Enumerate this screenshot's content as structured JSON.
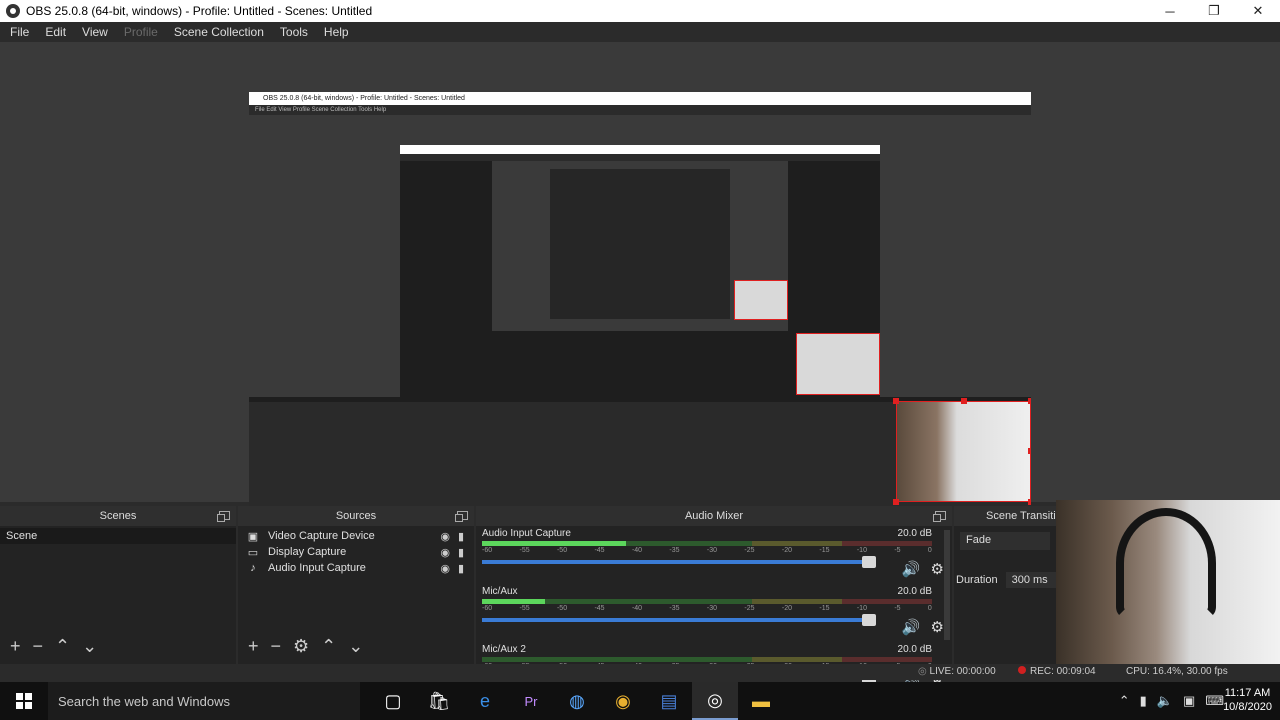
{
  "window": {
    "title": "OBS 25.0.8 (64-bit, windows) - Profile: Untitled - Scenes: Untitled",
    "minimize": "─",
    "restore": "❐",
    "close": "✕"
  },
  "menu": [
    "File",
    "Edit",
    "View",
    "Profile",
    "Scene Collection",
    "Tools",
    "Help"
  ],
  "preview": {
    "nested_title": "OBS 25.0.8 (64-bit, windows) - Profile: Untitled - Scenes: Untitled",
    "nested_menu": "File   Edit   View   Profile   Scene Collection   Tools   Help"
  },
  "scenes": {
    "title": "Scenes",
    "items": [
      "Scene"
    ]
  },
  "sources": {
    "title": "Sources",
    "items": [
      {
        "icon": "camera-icon",
        "glyph": "▣",
        "label": "Video Capture Device"
      },
      {
        "icon": "monitor-icon",
        "glyph": "▭",
        "label": "Display Capture"
      },
      {
        "icon": "microphone-icon",
        "glyph": "♪",
        "label": "Audio Input Capture"
      }
    ]
  },
  "mixer": {
    "title": "Audio Mixer",
    "ticks": [
      "-60",
      "-55",
      "-50",
      "-45",
      "-40",
      "-35",
      "-30",
      "-25",
      "-20",
      "-15",
      "-10",
      "-5",
      "0"
    ],
    "tracks": [
      {
        "name": "Audio Input Capture",
        "db": "20.0 dB",
        "level": 0.32,
        "volume": 1.0
      },
      {
        "name": "Mic/Aux",
        "db": "20.0 dB",
        "level": 0.14,
        "volume": 1.0
      },
      {
        "name": "Mic/Aux 2",
        "db": "20.0 dB",
        "level": 0.0,
        "volume": 1.0
      }
    ]
  },
  "transitions": {
    "title": "Scene Transitions",
    "selected": "Fade",
    "duration_label": "Duration",
    "duration_value": "300 ms"
  },
  "status": {
    "live": "LIVE: 00:00:00",
    "rec": "REC: 00:09:04",
    "cpu": "CPU: 16.4%, 30.00 fps"
  },
  "taskbar": {
    "search_placeholder": "Search the web and Windows",
    "time": "11:17 AM",
    "date": "10/8/2020"
  },
  "colors": {
    "accent": "#3a7bd5",
    "record": "#d02020",
    "selection": "#e02020"
  }
}
